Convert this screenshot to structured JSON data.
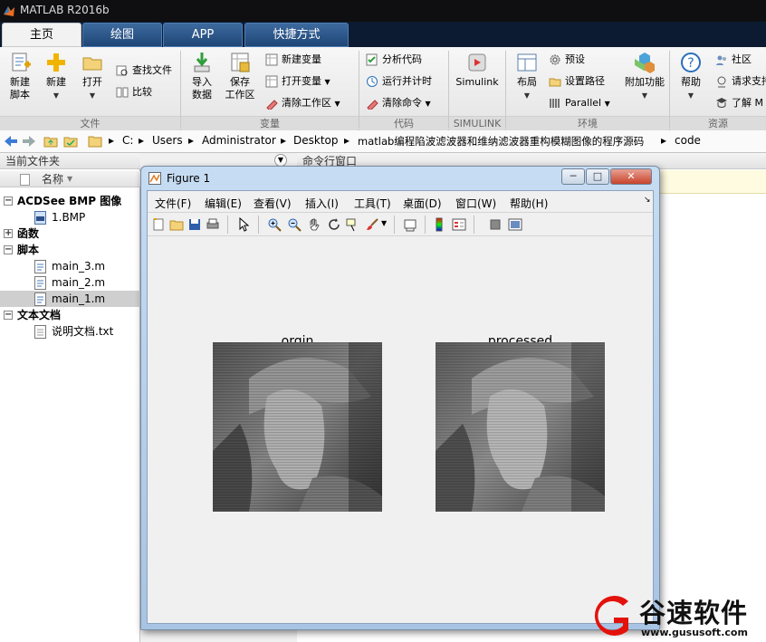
{
  "app": {
    "title": "MATLAB R2016b"
  },
  "tabs": [
    "主页",
    "绘图",
    "APP",
    "快捷方式"
  ],
  "ribbon": {
    "groups": {
      "file": "文件",
      "variable": "变量",
      "code": "代码",
      "simulink": "SIMULINK",
      "environment": "环境",
      "resources": "资源"
    },
    "new_script": [
      "新建",
      "脚本"
    ],
    "new": "新建",
    "open": "打开",
    "find_files": "查找文件",
    "compare": "比较",
    "import": [
      "导入",
      "数据"
    ],
    "save_ws": [
      "保存",
      "工作区"
    ],
    "new_var": "新建变量",
    "open_var": "打开变量",
    "clear_ws": "清除工作区",
    "analyze": "分析代码",
    "run_time": "运行并计时",
    "clear_cmd": "清除命令",
    "simulink": "Simulink",
    "layout": "布局",
    "prefs": "预设",
    "set_path": "设置路径",
    "parallel": "Parallel",
    "addons": "附加功能",
    "help": "帮助",
    "community": "社区",
    "request_support": "请求支持",
    "learn": "了解 M"
  },
  "address": {
    "crumbs": [
      "C:",
      "Users",
      "Administrator",
      "Desktop",
      "matlab编程陷波滤波器和维纳滤波器重构模糊图像的程序源码",
      "code"
    ]
  },
  "current_folder": {
    "header": "当前文件夹",
    "name_col": "名称",
    "tree": [
      {
        "label": "ACDSee BMP 图像",
        "group": true
      },
      {
        "label": "1.BMP",
        "group": false
      },
      {
        "label": "函数",
        "group": true
      },
      {
        "label": "脚本",
        "group": true
      },
      {
        "label": "main_3.m",
        "group": false
      },
      {
        "label": "main_2.m",
        "group": false
      },
      {
        "label": "main_1.m",
        "group": false
      },
      {
        "label": "文本文档",
        "group": true
      },
      {
        "label": "说明文档.txt",
        "group": false
      }
    ]
  },
  "command_window": {
    "header": "命令行窗口"
  },
  "figure": {
    "title": "Figure 1",
    "menu": [
      "文件(F)",
      "编辑(E)",
      "查看(V)",
      "插入(I)",
      "工具(T)",
      "桌面(D)",
      "窗口(W)",
      "帮助(H)"
    ],
    "axes": [
      {
        "title": "orgin"
      },
      {
        "title": "processed"
      }
    ]
  },
  "watermark": {
    "text": "谷速软件",
    "url": "www.gususoft.com"
  },
  "colors": {
    "ribbon_tab_active": "#f2f2f2",
    "ribbon_tab": "#2b5689",
    "titlebar": "#0f0f12",
    "brand_red": "#e3120b"
  }
}
